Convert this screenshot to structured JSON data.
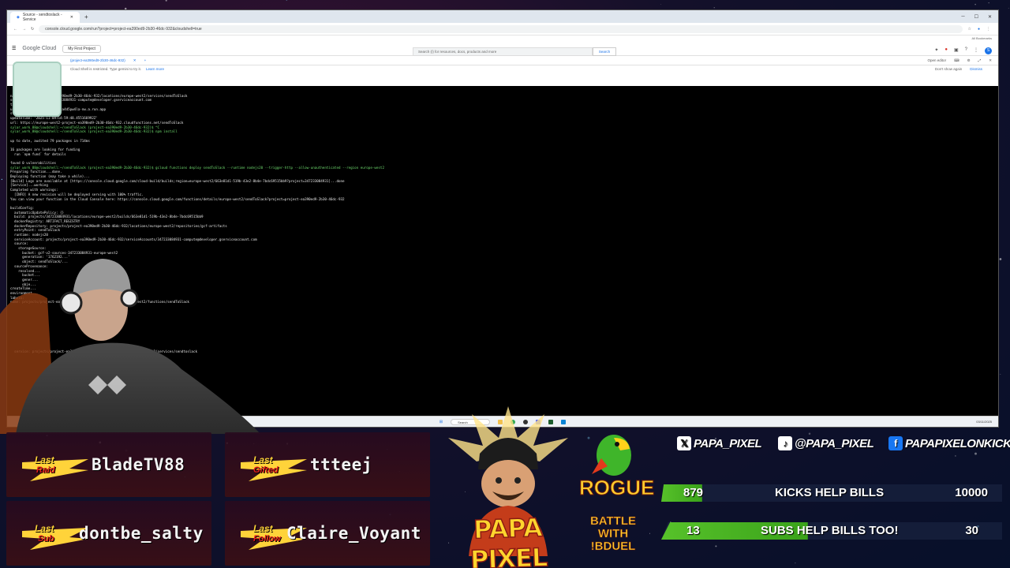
{
  "browser": {
    "tab_title": "Source - sendtoslack - Service",
    "url": "console.cloud.google.com/run?project=project-ea390ed9-2b30-46dc-932&cloudshell=true",
    "bookmarks_label": "All Bookmarks",
    "gc_logo": "Google Cloud",
    "project": "My First Project",
    "search_placeholder": "Search (/) for resources, docs, products and more",
    "search_button": "Search",
    "avatar_letter": "S",
    "shell_tab": "(project-ea390ed9-2b30-46dc-932)",
    "open_editor": "Open editor",
    "info_text": "Cloud Shell is restricted. Type gemini to try it.",
    "learn_more": "Learn more",
    "dont_show": "Don't show again",
    "dismiss": "Dismiss"
  },
  "terminal": {
    "lines": [
      {
        "t": ""
      },
      {
        "t": "name: projects/project-ea390ed9-2b30-46dc-932/locations/europe-west2/services/sendToSlack"
      },
      {
        "t": "serviceAccountEmail: 347233084931-compute@developer.gserviceaccount.com"
      },
      {
        "t": "timeoutSeconds: 60"
      },
      {
        "t": "uri: https://sendtoslack-ca4d5pw4la-nw.a.run.app"
      },
      {
        "t": "state: ACTIVE"
      },
      {
        "t": "updateTime: '2025-11-09T14:59:48.455166992Z'"
      },
      {
        "t": "url: https://europe-west2-project-ea390ed9-2b30-46dc-932.cloudfunctions.net/sendToSlack"
      },
      {
        "t": "sylar_work_88@cloudshell:~/sendToSlack (project-ea390ed9-2b30-46dc-932)$ ^C",
        "c": "p"
      },
      {
        "t": "sylar_work_88@cloudshell:~/sendToSlack (project-ea390ed9-2b30-46dc-932)$ npm install",
        "c": "p"
      },
      {
        "t": ""
      },
      {
        "t": "up to date, audited 79 packages in 714ms"
      },
      {
        "t": ""
      },
      {
        "t": "16 packages are looking for funding"
      },
      {
        "t": "  run `npm fund` for details"
      },
      {
        "t": ""
      },
      {
        "t": "found 0 vulnerabilities"
      },
      {
        "t": "sylar_work_88@cloudshell:~/sendToSlack (project-ea390ed9-2b30-46dc-932)$ gcloud functions deploy sendToSlack --runtime nodejs20 --trigger-http --allow-unauthenticated --region europe-west2",
        "c": "p"
      },
      {
        "t": "Preparing function...done."
      },
      {
        "t": "Deploying function (may take a while)..."
      },
      {
        "t": "[Build] Logs are available at [https://console.cloud.google.com/cloud-build/builds;region=europe-west2/663e81d1-519b-43e2-8b4e-7bdc69515bb9?project=347233084931]...done"
      },
      {
        "t": "[Service]...working"
      },
      {
        "t": "Completed with warnings:"
      },
      {
        "t": "  [INFO] A new revision will be deployed serving with 100% traffic."
      },
      {
        "t": "You can view your function in the Cloud Console here: https://console.cloud.google.com/functions/details/europe-west2/sendToSlack?project=project-ea390ed9-2b30-46dc-932"
      },
      {
        "t": ""
      },
      {
        "t": "buildConfig:"
      },
      {
        "t": "  automaticUpdatePolicy: {}"
      },
      {
        "t": "  build: projects/347233084931/locations/europe-west2/builds/663e81d1-519b-43e2-8b4e-7bdc69515bb9"
      },
      {
        "t": "  dockerRegistry: ARTIFACT_REGISTRY"
      },
      {
        "t": "  dockerRepository: projects/project-ea390ed9-2b30-46dc-932/locations/europe-west2/repositories/gcf-artifacts"
      },
      {
        "t": "  entryPoint: sendToSlack"
      },
      {
        "t": "  runtime: nodejs20"
      },
      {
        "t": "  serviceAccount: projects/project-ea390ed9-2b30-46dc-932/serviceAccounts/347233084931-compute@developer.gserviceaccount.com"
      },
      {
        "t": "  source:"
      },
      {
        "t": "    storageSource:"
      },
      {
        "t": "      bucket: gcf-v2-sources-347233084931-europe-west2"
      },
      {
        "t": "      generation: '1762192...'"
      },
      {
        "t": "      object: sendToSlack/..."
      },
      {
        "t": "  sourceProvenance:"
      },
      {
        "t": "    resolved..."
      },
      {
        "t": "      bucket..."
      },
      {
        "t": "      gener..."
      },
      {
        "t": "      obje..."
      },
      {
        "t": "createTime..."
      },
      {
        "t": "environment..."
      },
      {
        "t": "labels:"
      },
      {
        "t": "name: projects/project-ea390ed9-2b30-46dc-932/locations/europe-west2/functions/sendToSlack"
      },
      {
        "t": ""
      },
      {
        "t": ""
      },
      {
        "t": ""
      },
      {
        "t": ""
      },
      {
        "t": ""
      },
      {
        "t": ""
      },
      {
        "t": ""
      },
      {
        "t": ""
      },
      {
        "t": ""
      },
      {
        "t": ""
      },
      {
        "t": "  service: projects/project-ea390ed9-2b30-46dc-932/locations/europe-west2/services/sendtoslack"
      }
    ]
  },
  "taskbar": {
    "search": "Search",
    "clock": "03/11/2025"
  },
  "overlay": {
    "last_raid_label": "Last",
    "last_raid_sub": "Raid",
    "last_raid_name": "BladeTV88",
    "last_gifted_label": "Last",
    "last_gifted_sub": "Gifted",
    "last_gifted_name": "ttteej",
    "last_sub_label": "Last",
    "last_sub_sub": "Sub",
    "last_sub_name": "dontbe_salty",
    "last_follow_label": "Last",
    "last_follow_sub": "Follow",
    "last_follow_name": "Claire_Voyant",
    "logo_text": "PAPA PIXEL",
    "rogue": "ROGUE",
    "battle_1": "BATTLE",
    "battle_2": "WITH",
    "battle_3": "!BDUEL",
    "social_x": "PAPA_PIXEL",
    "social_tiktok": "@PAPA_PIXEL",
    "social_fb": "PAPAPIXELONKICK",
    "kicks_current": "879",
    "kicks_label": "KICKS HELP BILLS",
    "kicks_goal": "10000",
    "kicks_progress": 0.088,
    "subs_current": "13",
    "subs_label": "SUBS HELP BILLS TOO!",
    "subs_goal": "30",
    "subs_progress": 0.43
  },
  "colors": {
    "prompt_green": "#6fdc6f",
    "goal_bar": "#57c22a",
    "accent_yellow": "#ffd33a"
  }
}
